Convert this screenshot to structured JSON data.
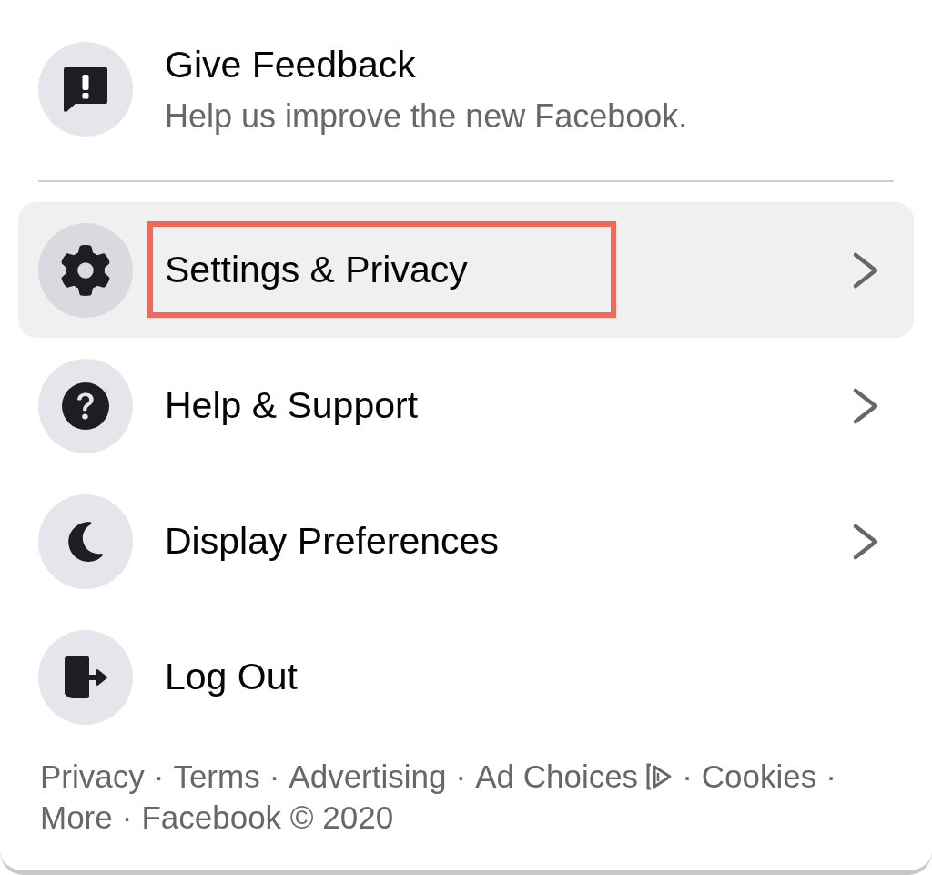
{
  "feedback": {
    "title": "Give Feedback",
    "subtitle": "Help us improve the new Facebook."
  },
  "menu_items": [
    {
      "label": "Settings & Privacy",
      "hovered": true,
      "annotated": true,
      "submenu": true
    },
    {
      "label": "Help & Support",
      "hovered": false,
      "annotated": false,
      "submenu": true
    },
    {
      "label": "Display Preferences",
      "hovered": false,
      "annotated": false,
      "submenu": true
    },
    {
      "label": "Log Out",
      "hovered": false,
      "annotated": false,
      "submenu": false
    }
  ],
  "footer": [
    {
      "kind": "link",
      "text": "Privacy"
    },
    {
      "kind": "separator",
      "text": "·"
    },
    {
      "kind": "link",
      "text": "Terms"
    },
    {
      "kind": "separator",
      "text": "·"
    },
    {
      "kind": "link",
      "text": "Advertising"
    },
    {
      "kind": "separator",
      "text": "·"
    },
    {
      "kind": "icon_link",
      "text": "Ad Choices"
    },
    {
      "kind": "separator",
      "text": "·"
    },
    {
      "kind": "link",
      "text": "Cookies"
    },
    {
      "kind": "separator",
      "text": "·"
    },
    {
      "kind": "link",
      "text": "More"
    },
    {
      "kind": "separator",
      "text": "·"
    },
    {
      "kind": "text",
      "text": "Facebook © 2020"
    }
  ]
}
